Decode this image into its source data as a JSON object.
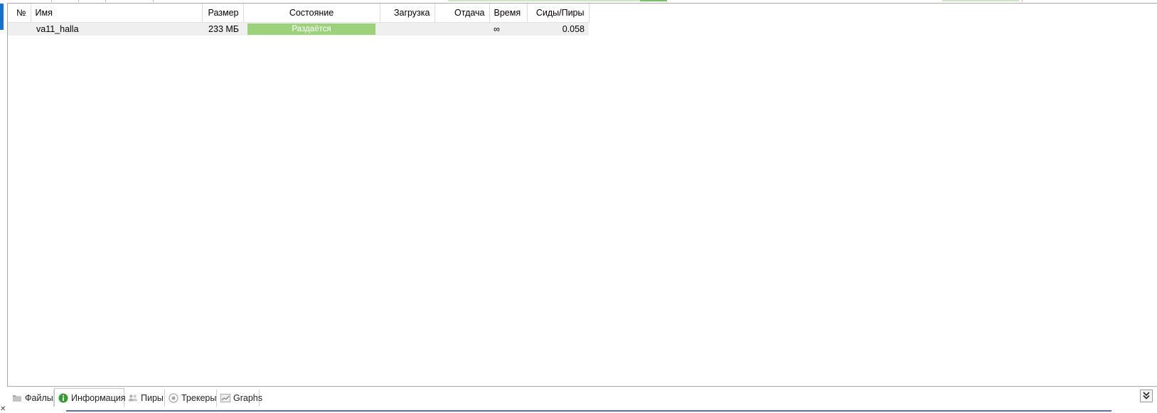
{
  "table": {
    "columns": {
      "num": "№",
      "name": "Имя",
      "size": "Размер",
      "state": "Состояние",
      "download": "Загрузка",
      "upload": "Отдача",
      "time": "Время",
      "seeds_peers": "Сиды/Пиры"
    },
    "rows": [
      {
        "num": "",
        "name": "va11_halla",
        "size": "233 МБ",
        "state": "Раздаётся",
        "download": "",
        "upload": "",
        "time": "∞",
        "seeds_peers": "0.058"
      }
    ]
  },
  "tabs": [
    {
      "label": "Файлы",
      "icon": "folder-icon"
    },
    {
      "label": "Информация",
      "icon": "info-icon",
      "active": true
    },
    {
      "label": "Пиры",
      "icon": "peers-icon"
    },
    {
      "label": "Трекеры",
      "icon": "tracker-icon"
    },
    {
      "label": "Graphs",
      "icon": "graph-icon"
    }
  ],
  "collapse_icon": "double-chevron-down-icon",
  "colors": {
    "state_seeding": "#9bd27b",
    "accent": "#1672d0"
  }
}
